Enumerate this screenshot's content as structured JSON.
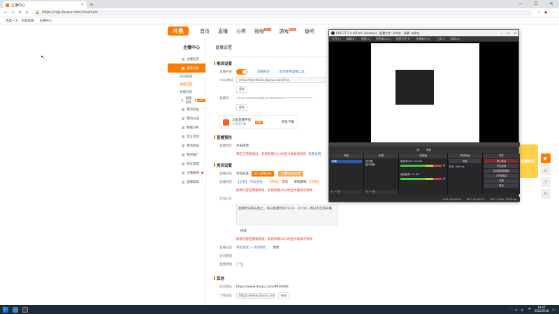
{
  "browser": {
    "tab_title": "主播中心",
    "url": "https://mp.douyu.com/live/main",
    "bookmarks": [
      "百度一下，你就知道",
      "主播中心"
    ]
  },
  "site": {
    "logo": "斗鱼",
    "nav": [
      "首页",
      "直播",
      "分类",
      "视频",
      "游戏",
      "鱼吧"
    ],
    "nav_badges": {
      "视频": "HOT",
      "游戏": "NEW"
    }
  },
  "sidebar": {
    "title": "主播中心",
    "items": [
      {
        "label": "主播任务"
      },
      {
        "label": "直播相关",
        "active": true
      },
      {
        "label": "房间管理",
        "sub": true
      },
      {
        "label": "直播设置",
        "sub": true,
        "selected": true
      },
      {
        "label": "直播记录",
        "sub": true
      },
      {
        "label": "视频创作"
      },
      {
        "label": "我的权益"
      },
      {
        "label": "我的分成"
      },
      {
        "label": "数据分析"
      },
      {
        "label": "官方活动"
      },
      {
        "label": "我的收益"
      },
      {
        "label": "我的推广"
      },
      {
        "label": "粉丝管理"
      },
      {
        "label": "主播保障"
      },
      {
        "label": "直播帮助"
      }
    ],
    "hot_badge": "HOT"
  },
  "content": {
    "page_title": "直播设置",
    "section1": "推流设置",
    "live_switch_label": "直播开关",
    "link_open": "直播规范",
    "link_help": "如何使用直播工具",
    "rtmp_label": "rtmp地址",
    "rtmp_value": "rtmp://sendtc3a.douyu.com/live",
    "copy1": "复制",
    "key_label": "直播码",
    "key_value": "7972124rXI9v8N13vkTaeYassc******************",
    "copy2": "复制",
    "card_title": "斗鱼直播伴侣",
    "card_sub": "可直接开播",
    "card_badge": "推荐",
    "card_btn": "前往下载",
    "section2": "直播预告",
    "preview_label": "直播预告",
    "preview_value": "点击修改",
    "preview_note": "预告已审核通过，有修改需24小时后才能再次修改",
    "preview_link": "查看说明",
    "section3": "房间设置",
    "room_label": "直播间名",
    "room_value": "可在此处",
    "btn_name": "进入直播间名",
    "btn_cover": "直播间封面设置",
    "tags_label": "直播标签",
    "tags": [
      "【主机】",
      "PS5主机",
      "【单机】",
      "游戏",
      "单机游戏",
      "【手游】"
    ],
    "tags_note": "修改内容后需要审核，有修改需24小时后才能再次修改",
    "notice_label": "房间公告",
    "notice_text": "直播时间每天晚上，每日直播时间19:30 - 24:00 - 周日不定期开播",
    "edit": "修改",
    "notice_warn": "修改内容后需要审核，有修改需24小时后才能再次修改",
    "category_label": "直播分类",
    "category_value": "单机游戏 > 其他单机",
    "category_edit": "修改",
    "moderator_label": "房间管理",
    "anchor_switch_label": "直播弹窗",
    "section4": "其他",
    "room_url_label": "房间地址",
    "room_url": "https://www.douyu.com/9916468",
    "share_label": "个性地址",
    "share_url": "https://www.douyu.com/",
    "share_btn": "修改"
  },
  "obs": {
    "title": "OBS 27.2.4 (64-bit, windows) - 配置文件: 未命名 - 场景: 未命名",
    "menu": [
      "文件(F)",
      "编辑(E)",
      "视图(V)",
      "停靠窗口(D)",
      "配置文件(P)",
      "场景集合(S)",
      "工具(T)",
      "帮助(H)"
    ],
    "preview_bar": [
      "源",
      "场景"
    ],
    "docks": {
      "scenes": {
        "title": "场景",
        "items": [
          "场景"
        ]
      },
      "sources": {
        "title": "来源",
        "items": [
          "显示器",
          "窗口捕获"
        ]
      },
      "mixer": {
        "title": "混音器",
        "rows": [
          {
            "name": "麦克风/Aux",
            "db": "0.0 dB"
          },
          {
            "name": "桌面音频",
            "db": "0.0 dB"
          }
        ]
      },
      "transitions": {
        "title": "转场动画",
        "value": "渐变",
        "duration_label": "时长",
        "duration": "300 ms"
      },
      "controls": {
        "title": "控件",
        "buttons": [
          "停止推流",
          "开始录制",
          "启动虚拟摄像机",
          "工作室模式",
          "设置",
          "退出"
        ]
      }
    },
    "status": [
      "LIVE: 00:00:00",
      "REC: 00:00:00",
      "CPU: 10.6%, 30.00 fps"
    ]
  },
  "float": {
    "live_label": "直播伴侣"
  },
  "taskbar": {
    "time": "19:07",
    "date": "2022/8/18"
  },
  "colors": {
    "accent": "#ff7a00",
    "link": "#3a76e0",
    "warn": "#e33333"
  }
}
